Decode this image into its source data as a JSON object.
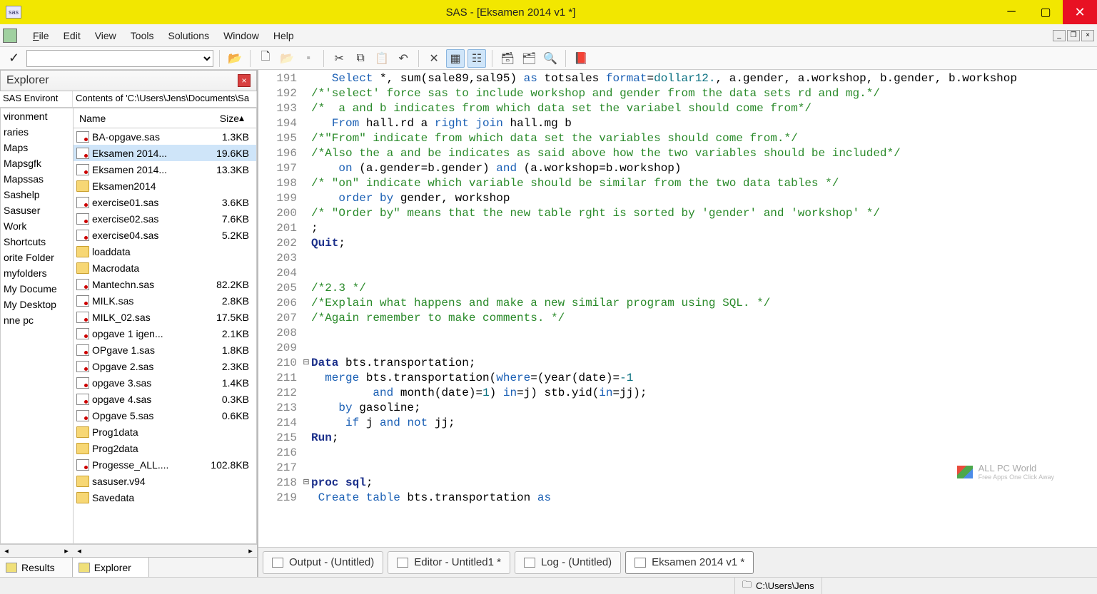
{
  "title": "SAS - [Eksamen 2014 v1 *]",
  "menu": [
    "File",
    "Edit",
    "View",
    "Tools",
    "Solutions",
    "Window",
    "Help"
  ],
  "explorer": {
    "label": "Explorer",
    "nav_left": "SAS Environt",
    "nav_right": "Contents of 'C:\\Users\\Jens\\Documents\\Sa",
    "headers": {
      "name": "Name",
      "size": "Size"
    },
    "side": [
      "vironment",
      "raries",
      "Maps",
      "Mapsgfk",
      "Mapssas",
      "Sashelp",
      "Sasuser",
      "Work",
      "Shortcuts",
      "orite Folder",
      "myfolders",
      "My Docume",
      "My Desktop",
      "nne pc"
    ],
    "files": [
      {
        "name": "BA-opgave.sas",
        "size": "1.3KB",
        "type": "sas"
      },
      {
        "name": "Eksamen 2014...",
        "size": "19.6KB",
        "type": "sas",
        "sel": true
      },
      {
        "name": "Eksamen 2014...",
        "size": "13.3KB",
        "type": "sas"
      },
      {
        "name": "Eksamen2014",
        "size": "",
        "type": "fld"
      },
      {
        "name": "exercise01.sas",
        "size": "3.6KB",
        "type": "sas"
      },
      {
        "name": "exercise02.sas",
        "size": "7.6KB",
        "type": "sas"
      },
      {
        "name": "exercise04.sas",
        "size": "5.2KB",
        "type": "sas"
      },
      {
        "name": "loaddata",
        "size": "",
        "type": "fld"
      },
      {
        "name": "Macrodata",
        "size": "",
        "type": "fld"
      },
      {
        "name": "Mantechn.sas",
        "size": "82.2KB",
        "type": "sas"
      },
      {
        "name": "MILK.sas",
        "size": "2.8KB",
        "type": "sas"
      },
      {
        "name": "MILK_02.sas",
        "size": "17.5KB",
        "type": "sas"
      },
      {
        "name": "opgave 1 igen...",
        "size": "2.1KB",
        "type": "sas"
      },
      {
        "name": "OPgave 1.sas",
        "size": "1.8KB",
        "type": "sas"
      },
      {
        "name": "Opgave 2.sas",
        "size": "2.3KB",
        "type": "sas"
      },
      {
        "name": "opgave 3.sas",
        "size": "1.4KB",
        "type": "sas"
      },
      {
        "name": "opgave 4.sas",
        "size": "0.3KB",
        "type": "sas"
      },
      {
        "name": "Opgave 5.sas",
        "size": "0.6KB",
        "type": "sas"
      },
      {
        "name": "Prog1data",
        "size": "",
        "type": "fld"
      },
      {
        "name": "Prog2data",
        "size": "",
        "type": "fld"
      },
      {
        "name": "Progesse_ALL....",
        "size": "102.8KB",
        "type": "sas"
      },
      {
        "name": "sasuser.v94",
        "size": "",
        "type": "fld"
      },
      {
        "name": "Savedata",
        "size": "",
        "type": "fld"
      }
    ],
    "tabs": [
      {
        "label": "Results"
      },
      {
        "label": "Explorer",
        "active": true
      }
    ]
  },
  "code": [
    {
      "n": 191,
      "html": "   <span class='bluekw'>Select</span> *, sum(sale89,sal95) <span class='bluekw'>as</span> totsales <span class='bluekw'>format</span>=<span class='tealkw'>dollar12.</span>, a.gender, a.workshop, b.gender, b.workshop"
    },
    {
      "n": 192,
      "html": "<span class='com'>/*'select' force sas to include workshop and gender from the data sets rd and mg.*/</span>"
    },
    {
      "n": 193,
      "html": "<span class='com'>/*  a and b indicates from which data set the variabel should come from*/</span>"
    },
    {
      "n": 194,
      "html": "   <span class='bluekw'>From</span> hall.rd a <span class='bluekw'>right join</span> hall.mg b"
    },
    {
      "n": 195,
      "html": "<span class='com'>/*\"From\" indicate from which data set the variables should come from.*/</span>"
    },
    {
      "n": 196,
      "html": "<span class='com'>/*Also the a and be indicates as said above how the two variables should be included*/</span>"
    },
    {
      "n": 197,
      "html": "    <span class='bluekw'>on</span> (a.gender=b.gender) <span class='bluekw'>and</span> (a.workshop=b.workshop)"
    },
    {
      "n": 198,
      "html": "<span class='com'>/* \"on\" indicate which variable should be similar from the two data tables */</span>"
    },
    {
      "n": 199,
      "html": "    <span class='bluekw'>order by</span> gender, workshop"
    },
    {
      "n": 200,
      "html": "<span class='com'>/* \"Order by\" means that the new table rght is sorted by 'gender' and 'workshop' */</span>"
    },
    {
      "n": 201,
      "html": ";"
    },
    {
      "n": 202,
      "html": "<span class='navykw'>Quit</span>;"
    },
    {
      "n": 203,
      "html": ""
    },
    {
      "n": 204,
      "html": ""
    },
    {
      "n": 205,
      "html": "<span class='com'>/*2.3 */</span>"
    },
    {
      "n": 206,
      "html": "<span class='com'>/*Explain what happens and make a new similar program using SQL. */</span>"
    },
    {
      "n": 207,
      "html": "<span class='com'>/*Again remember to make comments. */</span>"
    },
    {
      "n": 208,
      "html": ""
    },
    {
      "n": 209,
      "html": ""
    },
    {
      "n": 210,
      "fold": "⊟",
      "html": "<span class='navykw'>Data</span> bts.transportation;"
    },
    {
      "n": 211,
      "html": "  <span class='bluekw'>merge</span> bts.transportation(<span class='bluekw'>where</span>=(year(date)=<span class='tealkw'>-1</span>"
    },
    {
      "n": 212,
      "html": "         <span class='bluekw'>and</span> month(date)=<span class='tealkw'>1</span>) <span class='bluekw'>in</span>=j) stb.yid(<span class='bluekw'>in</span>=jj);"
    },
    {
      "n": 213,
      "html": "    <span class='bluekw'>by</span> gasoline;"
    },
    {
      "n": 214,
      "html": "     <span class='bluekw'>if</span> j <span class='bluekw'>and not</span> jj;"
    },
    {
      "n": 215,
      "html": "<span class='navykw'>Run</span>;"
    },
    {
      "n": 216,
      "html": ""
    },
    {
      "n": 217,
      "html": ""
    },
    {
      "n": 218,
      "fold": "⊟",
      "html": "<span class='navykw'>proc sql</span>;"
    },
    {
      "n": 219,
      "html": " <span class='bluekw'>Create table</span> bts.transportation <span class='bluekw'>as</span>"
    }
  ],
  "editor_tabs": [
    {
      "label": "Output - (Untitled)"
    },
    {
      "label": "Editor - Untitled1 *"
    },
    {
      "label": "Log - (Untitled)"
    },
    {
      "label": "Eksamen 2014 v1 *",
      "active": true
    }
  ],
  "status_path": "C:\\Users\\Jens",
  "watermark": {
    "title": "ALL PC World",
    "sub": "Free Apps One Click Away"
  }
}
